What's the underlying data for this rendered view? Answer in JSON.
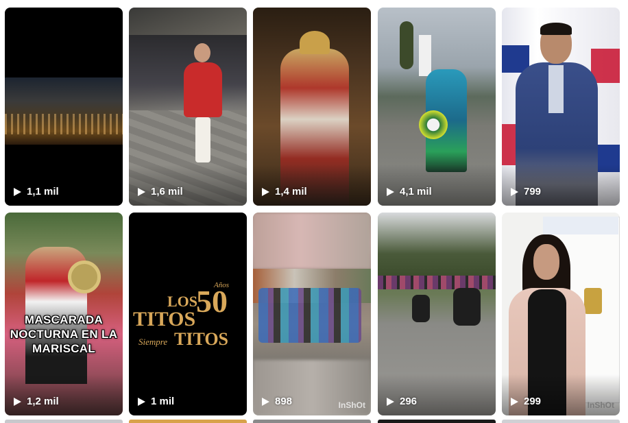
{
  "grid": {
    "tiles": [
      {
        "views": "1,1 mil"
      },
      {
        "views": "1,6 mil"
      },
      {
        "views": "1,4 mil"
      },
      {
        "views": "4,1 mil"
      },
      {
        "views": "799"
      },
      {
        "views": "1,2 mil",
        "caption": "MASCARADA NOCTURNA EN LA MARISCAL"
      },
      {
        "views": "1 mil",
        "logo": {
          "line1": "LOS",
          "number": "50",
          "years": "Años",
          "line2": "TITOS",
          "script": "Siempre",
          "line3": "TITOS"
        }
      },
      {
        "views": "898",
        "watermark": "InShOt"
      },
      {
        "views": "296"
      },
      {
        "views": "299",
        "watermark": "InShOt"
      }
    ]
  },
  "colors": {
    "play_icon": "#ffffff",
    "views_text": "#ffffff",
    "logo_gold": "#d9a85a"
  },
  "icons": {
    "play": "play-icon"
  }
}
